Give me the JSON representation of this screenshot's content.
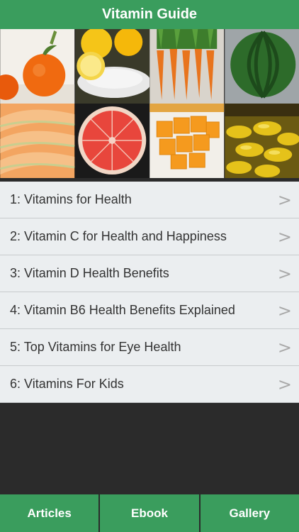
{
  "header": {
    "title": "Vitamin Guide"
  },
  "gallery": {
    "tiles": [
      "oranges",
      "lemon-squeezer",
      "carrots",
      "watermelon",
      "cantaloupe",
      "grapefruit",
      "papaya",
      "vitamin-capsules"
    ]
  },
  "list": {
    "items": [
      {
        "label": "1: Vitamins for Health",
        "chevron": ">"
      },
      {
        "label": "2: Vitamin C for Health and Happiness",
        "chevron": ">"
      },
      {
        "label": "3: Vitamin D Health Benefits",
        "chevron": ">"
      },
      {
        "label": "4: Vitamin B6 Health Benefits Explained",
        "chevron": ">"
      },
      {
        "label": "5: Top Vitamins for Eye Health",
        "chevron": ">"
      },
      {
        "label": "6: Vitamins For Kids",
        "chevron": ">"
      }
    ]
  },
  "tabs": [
    {
      "label": "Articles"
    },
    {
      "label": "Ebook"
    },
    {
      "label": "Gallery"
    }
  ],
  "colors": {
    "accent": "#3a9d5d",
    "background": "#2b2b2b",
    "list_bg": "#ebeef0"
  }
}
